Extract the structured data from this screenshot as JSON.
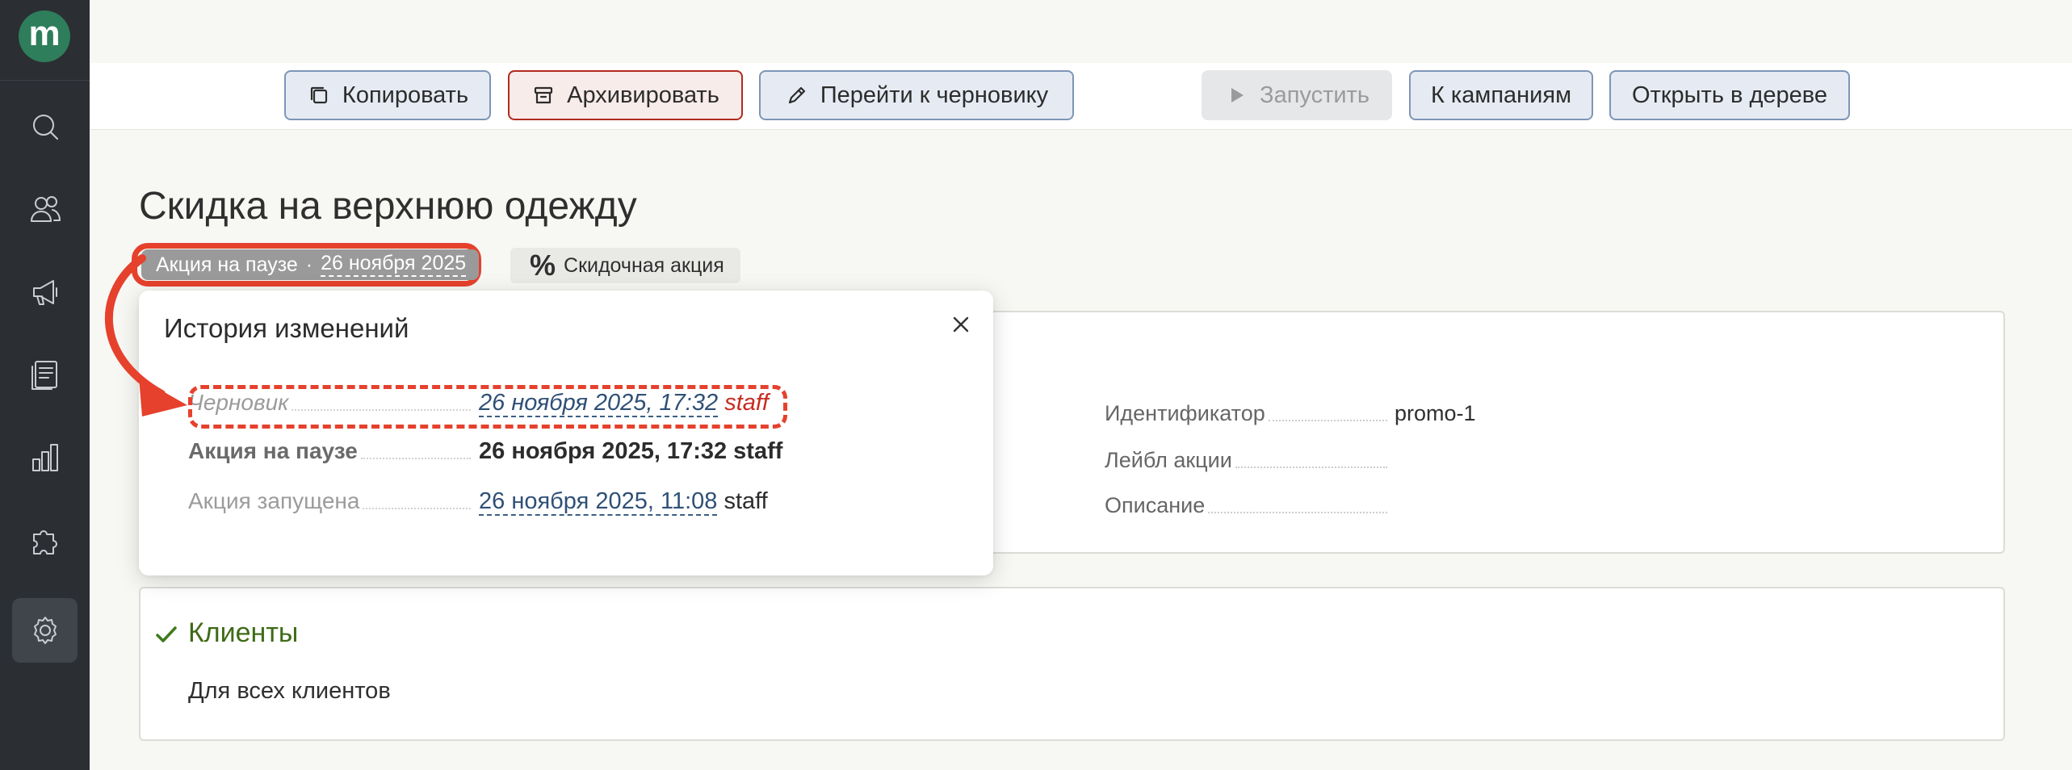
{
  "app": {
    "logo_letter": "m"
  },
  "sidebar": {
    "items": [
      {
        "name": "search"
      },
      {
        "name": "users"
      },
      {
        "name": "megaphone"
      },
      {
        "name": "receipt"
      },
      {
        "name": "bar-chart"
      },
      {
        "name": "puzzle"
      },
      {
        "name": "gear",
        "active": true
      }
    ]
  },
  "toolbar": {
    "copy_label": "Копировать",
    "archive_label": "Архивировать",
    "draft_label": "Перейти к черновику",
    "launch_label": "Запустить",
    "campaigns_label": "К кампаниям",
    "tree_label": "Открыть в дереве"
  },
  "page": {
    "title": "Скидка на верхнюю одежду",
    "status_text": "Акция на паузе",
    "status_separator": "·",
    "status_date": "26 ноября 2025",
    "type_symbol": "%",
    "type_label": "Скидочная акция"
  },
  "info": {
    "id_label": "Идентификатор",
    "id_value": "promo-1",
    "badge_label": "Лейбл акции",
    "desc_label": "Описание"
  },
  "clients": {
    "title": "Клиенты",
    "description": "Для всех клиентов"
  },
  "history_popup": {
    "title": "История изменений",
    "rows": [
      {
        "label": "Черновик",
        "date": "26 ноября 2025, 17:32",
        "user": "staff"
      },
      {
        "label": "Акция на паузе",
        "date": "26 ноября 2025, 17:32",
        "user": "staff"
      },
      {
        "label": "Акция запущена",
        "date": "26 ноября 2025, 11:08",
        "user": "staff"
      }
    ]
  },
  "colors": {
    "accent_red": "#e5412d",
    "sidebar_bg": "#2b2e33",
    "logo_green": "#2e7d5b",
    "button_border": "#7e95b8",
    "success_green": "#3e7b1b"
  }
}
